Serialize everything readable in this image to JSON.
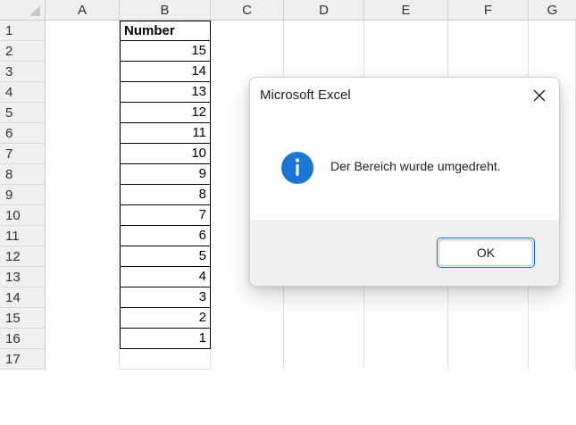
{
  "spreadsheet": {
    "columns": [
      "A",
      "B",
      "C",
      "D",
      "E",
      "F",
      "G"
    ],
    "rows": [
      "1",
      "2",
      "3",
      "4",
      "5",
      "6",
      "7",
      "8",
      "9",
      "10",
      "11",
      "12",
      "13",
      "14",
      "15",
      "16",
      "17"
    ],
    "column_b": {
      "header": "Number",
      "values": [
        "15",
        "14",
        "13",
        "12",
        "11",
        "10",
        "9",
        "8",
        "7",
        "6",
        "5",
        "4",
        "3",
        "2",
        "1"
      ]
    }
  },
  "dialog": {
    "title": "Microsoft Excel",
    "close_icon": "close-icon",
    "info_icon": "info-icon",
    "message": "Der Bereich wurde umgedreht.",
    "ok_label": "OK",
    "accent_color": "#1565c0"
  }
}
